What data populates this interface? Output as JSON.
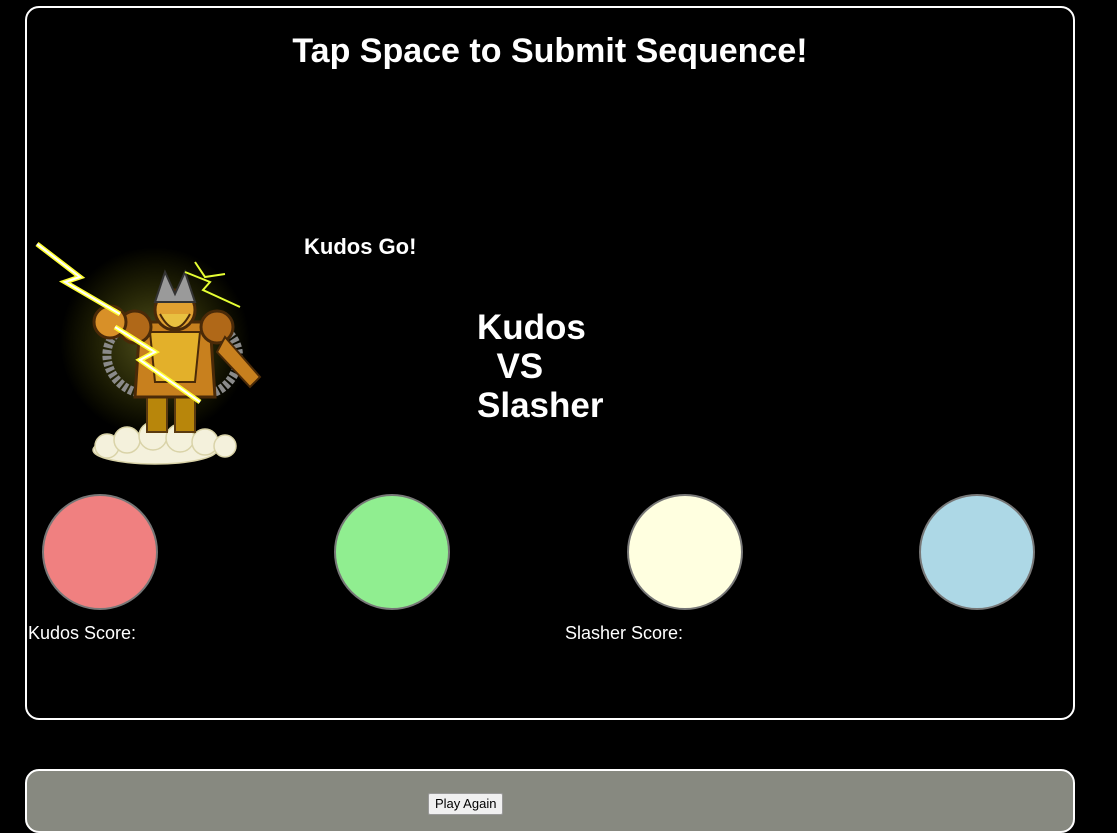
{
  "header": {
    "instruction": "Tap Space to Submit Sequence!"
  },
  "status": {
    "turn_message": "Kudos Go!"
  },
  "matchup": {
    "player1": "Kudos",
    "vs": "VS",
    "player2": "Slasher"
  },
  "character": {
    "name": "Kudos",
    "icon": "thunder-warrior-icon"
  },
  "pads": [
    {
      "name": "red",
      "color": "#F08080"
    },
    {
      "name": "green",
      "color": "#90EE90"
    },
    {
      "name": "yellow",
      "color": "#FFFFE0"
    },
    {
      "name": "blue",
      "color": "#ADD8E6"
    }
  ],
  "scores": {
    "player1_label": "Kudos Score:",
    "player2_label": "Slasher Score:"
  },
  "controls": {
    "play_again_label": "Play Again"
  }
}
